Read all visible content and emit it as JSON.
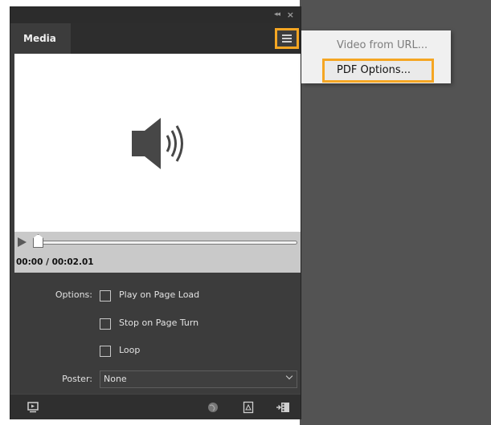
{
  "panel": {
    "tab_title": "Media",
    "time_display": "00:00 / 00:02.01",
    "options_label": "Options:",
    "options": [
      {
        "label": "Play on Page Load",
        "checked": false
      },
      {
        "label": "Stop on Page Turn",
        "checked": false
      },
      {
        "label": "Loop",
        "checked": false
      }
    ],
    "poster_label": "Poster:",
    "poster_value": "None",
    "playback_position": 0
  },
  "flyout_menu": {
    "items": [
      {
        "label": "Video from URL...",
        "highlighted": false
      },
      {
        "label": "PDF Options...",
        "highlighted": true
      }
    ]
  },
  "icons": {
    "collapse": "double-chevron-left-icon",
    "close": "close-icon",
    "panel_menu": "hamburger-menu-icon",
    "preview": "speaker-icon",
    "play": "play-icon",
    "footer": [
      "preview-slide-icon",
      "globe-icon",
      "pdf-icon",
      "insert-media-icon"
    ]
  },
  "colors": {
    "highlight": "#f5a623",
    "panel_bg": "#3c3c3c",
    "canvas_bg": "#535353"
  }
}
